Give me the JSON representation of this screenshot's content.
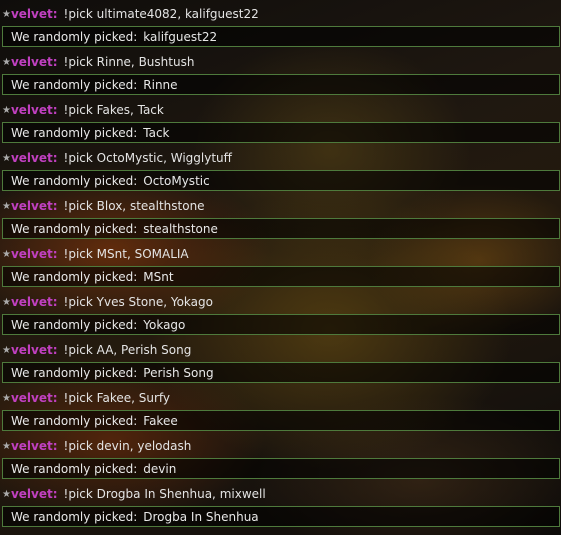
{
  "chat": {
    "star": "★",
    "result_prefix": "We randomly picked:",
    "entries": [
      {
        "user": "velvet:",
        "command": "!pick ultimate4082, kalifguest22",
        "result": "kalifguest22"
      },
      {
        "user": "velvet:",
        "command": "!pick Rinne, Bushtush",
        "result": "Rinne"
      },
      {
        "user": "velvet:",
        "command": "!pick Fakes, Tack",
        "result": "Tack"
      },
      {
        "user": "velvet:",
        "command": "!pick OctoMystic, Wigglytuff",
        "result": "OctoMystic"
      },
      {
        "user": "velvet:",
        "command": "!pick Blox, stealthstone",
        "result": "stealthstone"
      },
      {
        "user": "velvet:",
        "command": "!pick MSnt, SOMALIA",
        "result": "MSnt"
      },
      {
        "user": "velvet:",
        "command": "!pick Yves Stone, Yokago",
        "result": "Yokago"
      },
      {
        "user": "velvet:",
        "command": "!pick AA, Perish Song",
        "result": "Perish Song"
      },
      {
        "user": "velvet:",
        "command": "!pick Fakee, Surfy",
        "result": "Fakee"
      },
      {
        "user": "velvet:",
        "command": "!pick devin, yelodash",
        "result": "devin"
      },
      {
        "user": "velvet:",
        "command": "!pick Drogba In Shenhua, mixwell",
        "result": "Drogba In Shenhua"
      }
    ]
  },
  "colors": {
    "username": "#c040c0",
    "result_border": "#4e7a3c"
  }
}
